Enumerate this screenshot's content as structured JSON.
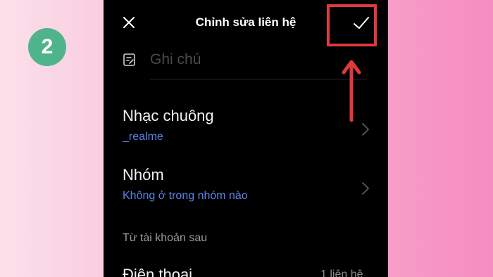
{
  "step": {
    "number": "2"
  },
  "header": {
    "title": "Chỉnh sửa liên hệ",
    "close_icon": "close-icon",
    "confirm_icon": "checkmark-icon"
  },
  "note": {
    "icon": "note-edit-icon",
    "placeholder": "Ghi chú",
    "value": ""
  },
  "rows": [
    {
      "label": "Nhạc chuông",
      "value": "_realme"
    },
    {
      "label": "Nhóm",
      "value": "Không ở trong nhóm nào"
    }
  ],
  "section": {
    "title": "Từ tài khoản sau"
  },
  "phone": {
    "label": "Điện thoại",
    "count": "1 liên hệ"
  },
  "colors": {
    "background": "#000000",
    "accent_blue": "#5a83e6",
    "highlight_red": "#e0393b",
    "badge_green": "#4fb48c"
  }
}
